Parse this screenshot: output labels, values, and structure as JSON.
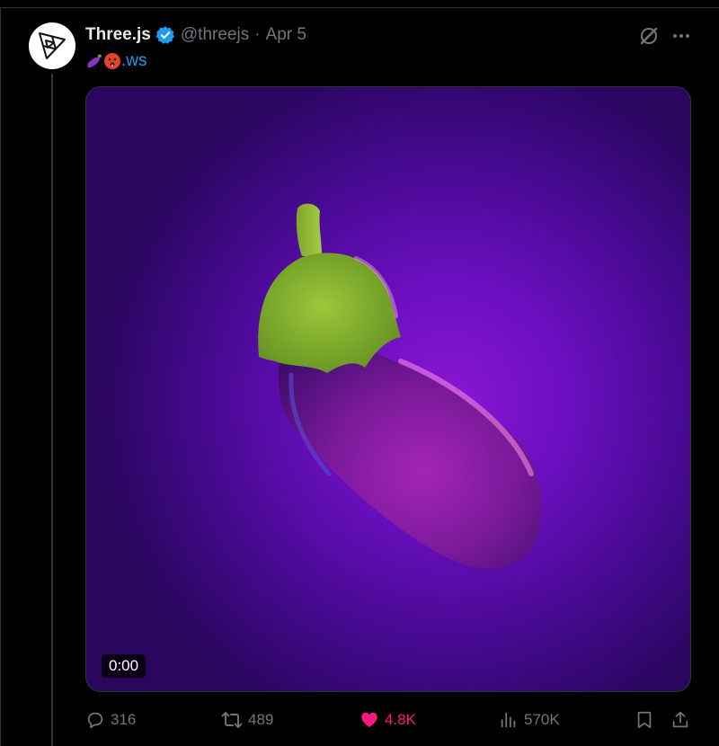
{
  "tweet": {
    "author_name": "Three.js",
    "handle": "@threejs",
    "separator": "·",
    "date": "Apr 5",
    "text_link": ".ws",
    "emojis": [
      "eggplant-icon",
      "hot-face-icon"
    ],
    "verified_icon": "verified-badge-icon"
  },
  "media": {
    "type": "video",
    "timestamp": "0:00"
  },
  "actions": {
    "replies": "316",
    "retweets": "489",
    "likes": "4.8K",
    "views": "570K"
  },
  "colors": {
    "accent": "#1d9bf0",
    "like": "#f91880",
    "muted": "#71767b",
    "text": "#e7e9ea",
    "background": "#000000"
  }
}
